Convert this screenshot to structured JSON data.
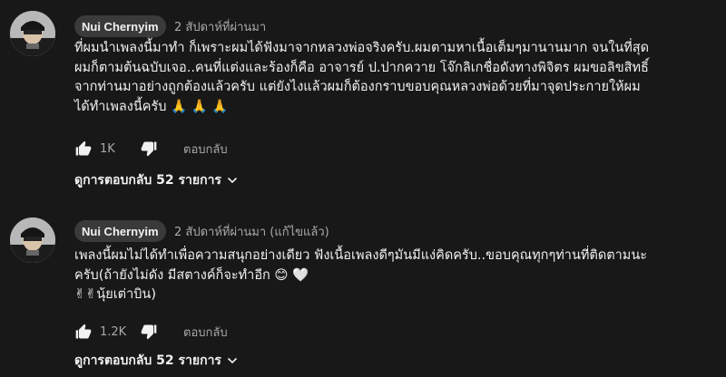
{
  "comments": [
    {
      "author": "Nui Chernyim",
      "timestamp": "2 สัปดาห์ที่ผ่านมา",
      "lines": [
        "ที่ผมนำเพลงนี้มาทำ ก็เพราะผมได้ฟังมาจากหลวงพ่อจริงครับ.ผมตามหาเนื้อเต็มๆมานานมาก จนในที่สุด",
        "ผมก็ตามต้นฉบับเจอ..คนที่แต่งและร้องก็คือ อาจารย์ ป.ปากควาย โจ๊กลิเกชื่อดังทางพิจิตร ผมขอลิขสิทธิ์",
        "จากท่านมาอย่างถูกต้องแล้วครับ แต่ยังไงแล้วผมก็ต้องกราบขอบคุณหลวงพ่อด้วยที่มาจุดประกายให้ผม",
        "ได้ทำเพลงนี้ครับ 🙏 🙏 🙏"
      ],
      "likes": "1K",
      "reply_label": "ตอบกลับ",
      "replies_label": "ดูการตอบกลับ 52 รายการ"
    },
    {
      "author": "Nui Chernyim",
      "timestamp": "2 สัปดาห์ที่ผ่านมา (แก้ไขแล้ว)",
      "lines": [
        "เพลงนี้ผมไม่ได้ทำเพื่อความสนุกอย่างเดียว ฟังเนื้อเพลงดีๆมันมีแง่คิดครับ..ขอบคุณทุกๆท่านที่ติดตามนะ",
        "ครับ(ถ้ายังไม่ดัง มีสตางค์ก็จะทำอีก 😊 🤍",
        "✌✌นุ้ยเต่าบิน)"
      ],
      "likes": "1.2K",
      "reply_label": "ตอบกลับ",
      "replies_label": "ดูการตอบกลับ 52 รายการ"
    }
  ],
  "colors": {
    "background": "#181818",
    "text": "#f1f1f1",
    "secondary": "#aaaaaa",
    "chip": "#3a3a3a"
  }
}
